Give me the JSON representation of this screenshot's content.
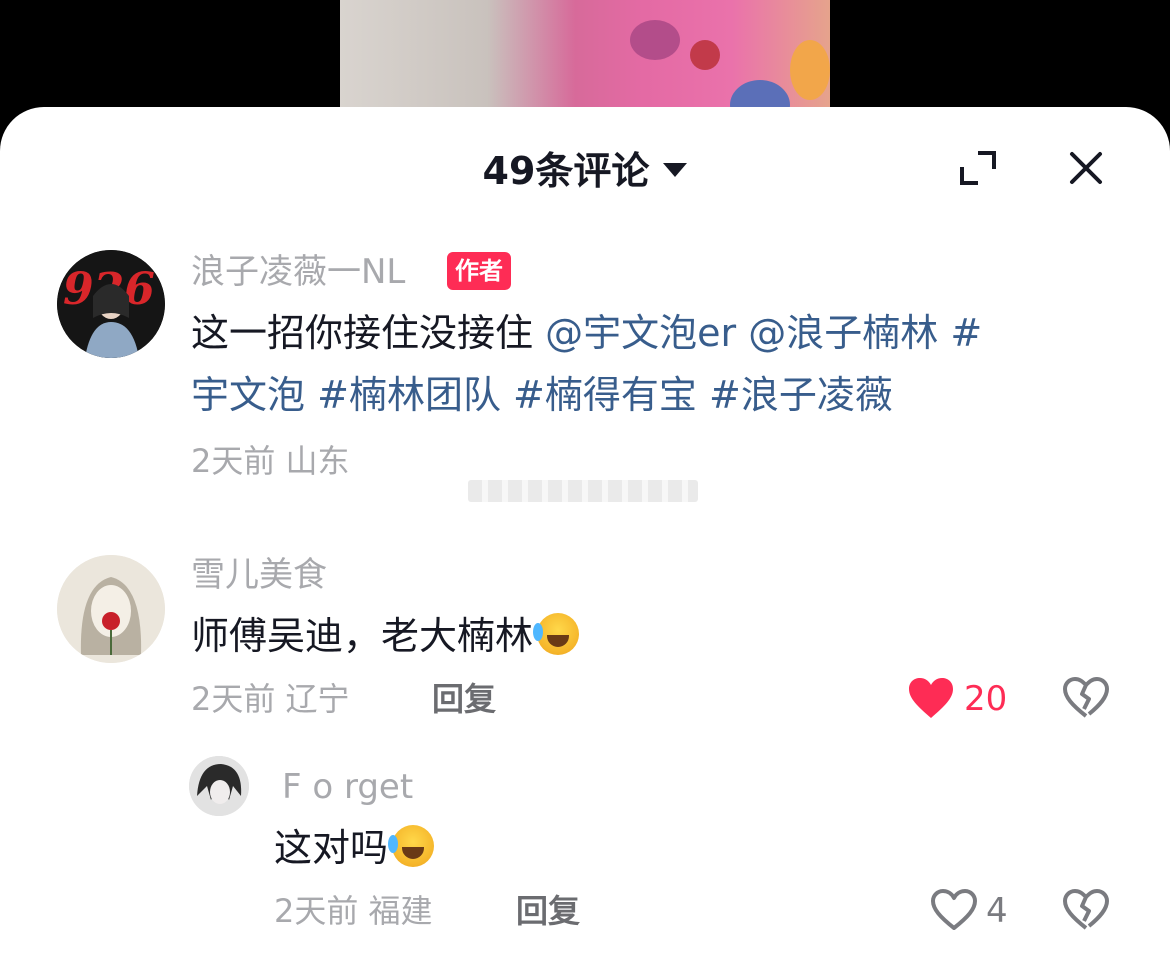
{
  "header": {
    "title": "49条评论"
  },
  "icons": {
    "expand": "expand-icon",
    "close": "close-icon",
    "dropdown": "chevron-down-icon",
    "like_filled": "heart-filled-icon",
    "like_outline": "heart-outline-icon",
    "dislike": "broken-heart-icon"
  },
  "colors": {
    "accent_red": "#fe2c55",
    "mention_blue": "#385d8c",
    "text_primary": "#161823",
    "text_secondary": "#a8a9ad"
  },
  "comments": [
    {
      "username": "浪子凌薇一NL",
      "badge": "作者",
      "text_plain": "这一招你接住没接住 ",
      "mentions": [
        "@宇文泡er",
        "@浪子楠林",
        "#"
      ],
      "line2": [
        "宇文泡",
        "#楠林团队",
        "#楠得有宝",
        "#浪子凌薇"
      ],
      "time": "2天前",
      "location": "山东"
    },
    {
      "username": "雪儿美食",
      "text": "师傅吴迪，老大楠林",
      "time": "2天前",
      "location": "辽宁",
      "reply_label": "回复",
      "likes": "20",
      "liked": true
    },
    {
      "username": "F o rget",
      "text": "这对吗",
      "time": "2天前",
      "location": "福建",
      "reply_label": "回复",
      "likes": "4",
      "liked": false
    }
  ]
}
